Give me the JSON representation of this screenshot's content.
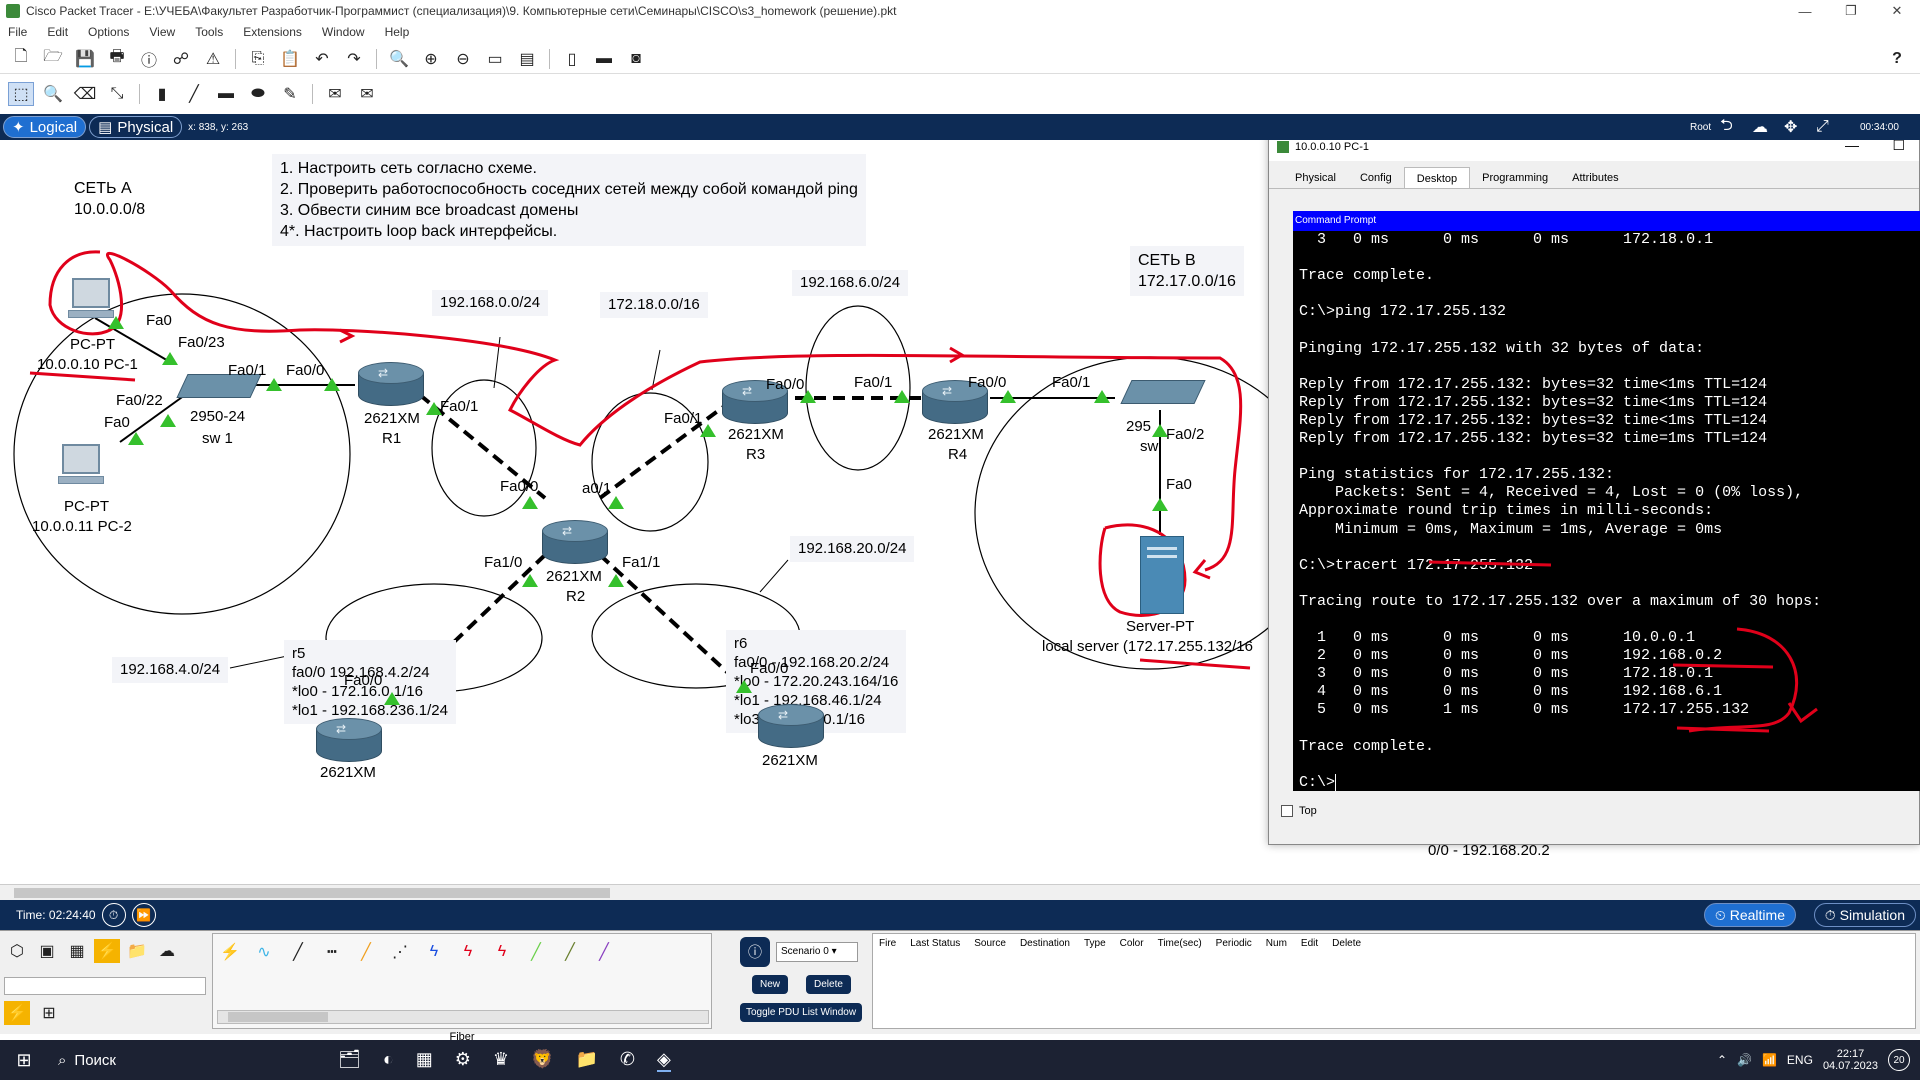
{
  "app": {
    "title": "Cisco Packet Tracer - E:\\УЧЕБА\\Факультет Разработчик-Программист (специализация)\\9. Компьютерные сети\\Семинары\\CISCO\\s3_homework (решение).pkt",
    "menu": [
      "File",
      "Edit",
      "Options",
      "View",
      "Tools",
      "Extensions",
      "Window",
      "Help"
    ],
    "window_controls": [
      "—",
      "❐",
      "✕"
    ]
  },
  "modebar": {
    "logical": "Logical",
    "physical": "Physical",
    "coords": "x: 838, y: 263",
    "root": "Root",
    "clock": "00:34:00"
  },
  "notes": {
    "task": [
      "1. Настроить сеть согласно схеме.",
      "2. Проверить работоспособность соседних сетей между собой командой ping",
      "3. Обвести синим все broadcast домены",
      "4*. Настроить loop back интерфейсы."
    ],
    "net_a": [
      "СЕТЬ А",
      "10.0.0.0/8"
    ],
    "net_b": [
      "СЕТЬ В",
      "172.17.0.0/16"
    ],
    "r5": [
      "r5",
      "fa0/0 192.168.4.2/24",
      "*lo0 - 172.16.0.1/16",
      "*lo1 - 192.168.236.1/24"
    ],
    "r6": [
      "r6",
      "fa0/0 - 192.168.20.2/24",
      "*lo0 - 172.20.243.164/16",
      "*lo1 - 192.168.46.1/24",
      "*lo3 - 172.31.0.1/16"
    ]
  },
  "networks": {
    "n1": "192.168.0.0/24",
    "n2": "172.18.0.0/16",
    "n3": "192.168.6.0/24",
    "n4": "192.168.20.0/24",
    "n5": "192.168.4.0/24",
    "n6": "0/0 - 192.168.20.2"
  },
  "devices": {
    "pc1": {
      "l1": "PC-PT",
      "l2": "10.0.0.10 PC-1"
    },
    "pc2": {
      "l1": "PC-PT",
      "l2": "10.0.0.11 PC-2"
    },
    "sw1": {
      "l1": "2950-24",
      "l2": "sw 1"
    },
    "r1": {
      "l1": "2621XM",
      "l2": "R1"
    },
    "r2": {
      "l1": "2621XM",
      "l2": "R2"
    },
    "r3": {
      "l1": "2621XM",
      "l2": "R3"
    },
    "r4": {
      "l1": "2621XM",
      "l2": "R4"
    },
    "r5": {
      "l1": "2621XM"
    },
    "r6": {
      "l1": "2621XM"
    },
    "sw2": {
      "l1": "295",
      "l2": "sw"
    },
    "server": {
      "l1": "Server-PT",
      "l2": "local server (172.17.255.132/16"
    }
  },
  "ports": {
    "pc1_fa0": "Fa0",
    "sw1_fa023": "Fa0/23",
    "sw1_fa01": "Fa0/1",
    "r1_fa00": "Fa0/0",
    "sw1_fa022": "Fa0/22",
    "pc2_fa0": "Fa0",
    "r1_fa01": "Fa0/1",
    "r2_fa00": "Fa0/0",
    "r2_fa01": "a0/1",
    "r3_fa01": "Fa0/1",
    "r3_fa00": "Fa0/0",
    "r4_fa01_l": "Fa0/1",
    "r4_fa00": "Fa0/0",
    "r4_fa01": "Fa0/1",
    "sw2_fa02": "Fa0/2",
    "srv_fa0": "Fa0",
    "r2_fa10": "Fa1/0",
    "r2_fa11": "Fa1/1",
    "r5_fa00": "Fa0/0",
    "r6_fa00": "Fa0/0"
  },
  "pc_window": {
    "title": "10.0.0.10 PC-1",
    "tabs": [
      "Physical",
      "Config",
      "Desktop",
      "Programming",
      "Attributes"
    ],
    "active_tab": "Desktop",
    "cmd_title": "Command Prompt",
    "top_checkbox": "Top",
    "console": [
      "  3   0 ms      0 ms      0 ms      172.18.0.1",
      "",
      "Trace complete.",
      "",
      "C:\\>ping 172.17.255.132",
      "",
      "Pinging 172.17.255.132 with 32 bytes of data:",
      "",
      "Reply from 172.17.255.132: bytes=32 time<1ms TTL=124",
      "Reply from 172.17.255.132: bytes=32 time<1ms TTL=124",
      "Reply from 172.17.255.132: bytes=32 time<1ms TTL=124",
      "Reply from 172.17.255.132: bytes=32 time=1ms TTL=124",
      "",
      "Ping statistics for 172.17.255.132:",
      "    Packets: Sent = 4, Received = 4, Lost = 0 (0% loss),",
      "Approximate round trip times in milli-seconds:",
      "    Minimum = 0ms, Maximum = 1ms, Average = 0ms",
      "",
      "C:\\>tracert 172.17.255.132",
      "",
      "Tracing route to 172.17.255.132 over a maximum of 30 hops:",
      "",
      "  1   0 ms      0 ms      0 ms      10.0.0.1",
      "  2   0 ms      0 ms      0 ms      192.168.0.2",
      "  3   0 ms      0 ms      0 ms      172.18.0.1",
      "  4   0 ms      0 ms      0 ms      192.168.6.1",
      "  5   0 ms      1 ms      0 ms      172.17.255.132",
      "",
      "Trace complete.",
      "",
      "C:\\>"
    ]
  },
  "sim": {
    "time": "Time: 02:24:40",
    "realtime": "Realtime",
    "simulation": "Simulation"
  },
  "bottom": {
    "conn_label": "Fiber",
    "scenario": "Scenario 0",
    "new": "New",
    "delete": "Delete",
    "toggle": "Toggle PDU List Window",
    "pdu_cols": [
      "Fire",
      "Last Status",
      "Source",
      "Destination",
      "Type",
      "Color",
      "Time(sec)",
      "Periodic",
      "Num",
      "Edit",
      "Delete"
    ]
  },
  "taskbar": {
    "search": "Поиск",
    "lang": "ENG",
    "time": "22:17",
    "date": "04.07.2023",
    "notif": "20"
  },
  "colors": {
    "link_green": "#35c02c",
    "annot_red": "#e0001a",
    "mode_bar": "#0d2b55",
    "cmd_header": "#0000ff"
  }
}
